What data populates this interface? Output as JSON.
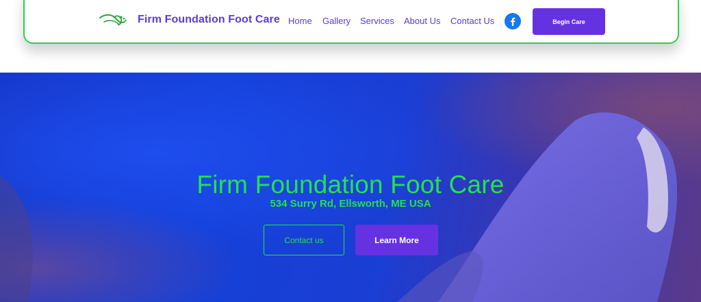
{
  "header": {
    "brand": "Firm Foundation Foot Care",
    "nav": [
      {
        "label": "Home"
      },
      {
        "label": "Gallery"
      },
      {
        "label": "Services"
      },
      {
        "label": "About Us"
      },
      {
        "label": "Contact Us"
      }
    ],
    "social_icon": "facebook-icon",
    "cta_label": "Begin Care"
  },
  "hero": {
    "title": "Firm Foundation Foot Care",
    "address": "534 Surry Rd, Ellsworth, ME USA",
    "primary_button": "Contact us",
    "secondary_button": "Learn More"
  },
  "colors": {
    "accent_purple": "#6532e2",
    "brand_text": "#5a3ad8",
    "accent_green": "#22e34a",
    "border_green": "#2ed14a",
    "facebook_blue": "#1877f2"
  }
}
